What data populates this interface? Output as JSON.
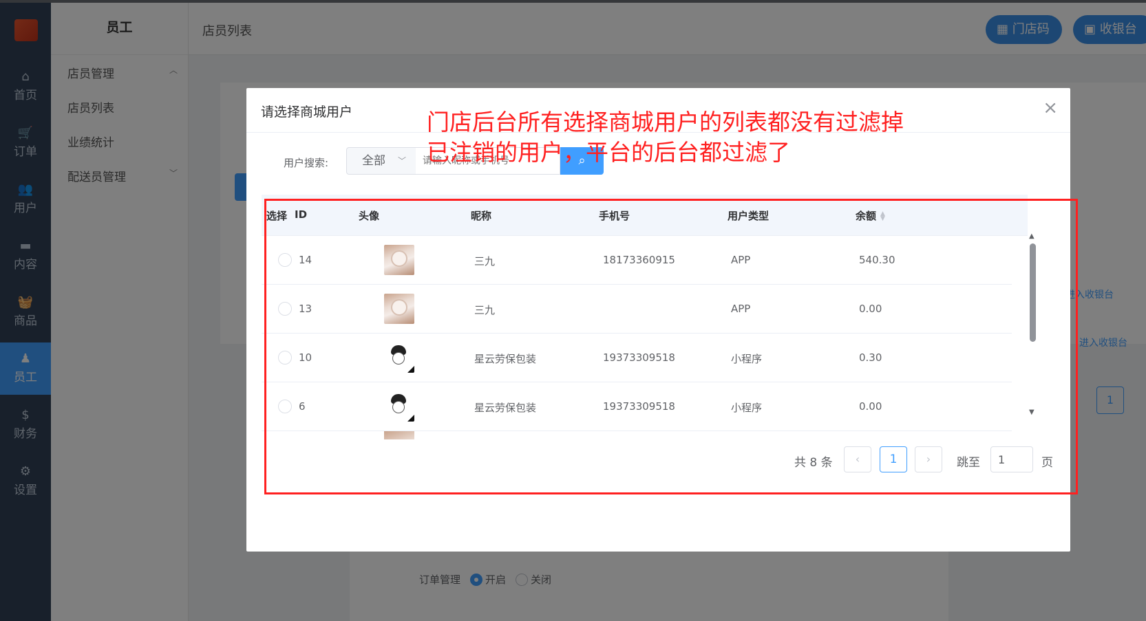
{
  "rail": {
    "items": [
      {
        "label": "首页",
        "icon": "⌂"
      },
      {
        "label": "订单",
        "icon": "🛒"
      },
      {
        "label": "用户",
        "icon": "👥"
      },
      {
        "label": "内容",
        "icon": "▬"
      },
      {
        "label": "商品",
        "icon": "🧺"
      },
      {
        "label": "员工",
        "icon": "♟"
      },
      {
        "label": "财务",
        "icon": "$"
      },
      {
        "label": "设置",
        "icon": "⚙"
      }
    ]
  },
  "submenu": {
    "title": "员工",
    "items": [
      "店员管理",
      "店员列表",
      "业绩统计",
      "配送员管理"
    ]
  },
  "topbar": {
    "breadcrumb": "店员列表",
    "store_code_label": "门店码",
    "cashier_label": "收银台"
  },
  "background": {
    "link1": "进入收银台",
    "link2": "进入收银台",
    "page_num": "1",
    "order_mgmt_label": "订单管理",
    "on_label": "开启",
    "off_label": "关闭"
  },
  "dialog": {
    "title": "请选择商城用户",
    "search": {
      "label": "用户搜索:",
      "select_value": "全部",
      "placeholder": "请输入昵称或手机号"
    },
    "table": {
      "columns": [
        "选择",
        "ID",
        "头像",
        "昵称",
        "手机号",
        "用户类型",
        "余额"
      ],
      "rows": [
        {
          "id": "14",
          "avatar": "photo",
          "nickname": "三九",
          "phone": "18173360915",
          "type": "APP",
          "balance": "540.30"
        },
        {
          "id": "13",
          "avatar": "photo",
          "nickname": "三九",
          "phone": "",
          "type": "APP",
          "balance": "0.00"
        },
        {
          "id": "10",
          "avatar": "sketch",
          "nickname": "星云劳保包装",
          "phone": "19373309518",
          "type": "小程序",
          "balance": "0.30"
        },
        {
          "id": "6",
          "avatar": "sketch",
          "nickname": "星云劳保包装",
          "phone": "19373309518",
          "type": "小程序",
          "balance": "0.00"
        }
      ]
    },
    "pagination": {
      "total": "共 8 条",
      "current_page": "1",
      "jump_label": "跳至",
      "jump_value": "1",
      "page_unit": "页"
    }
  },
  "annotation": {
    "text": "门店后台所有选择商城用户的列表都没有过滤掉已注销的用户，平台的后台都过滤了",
    "color": "#ff2020"
  },
  "colors": {
    "primary": "#409eff",
    "rail_bg": "#304156"
  }
}
